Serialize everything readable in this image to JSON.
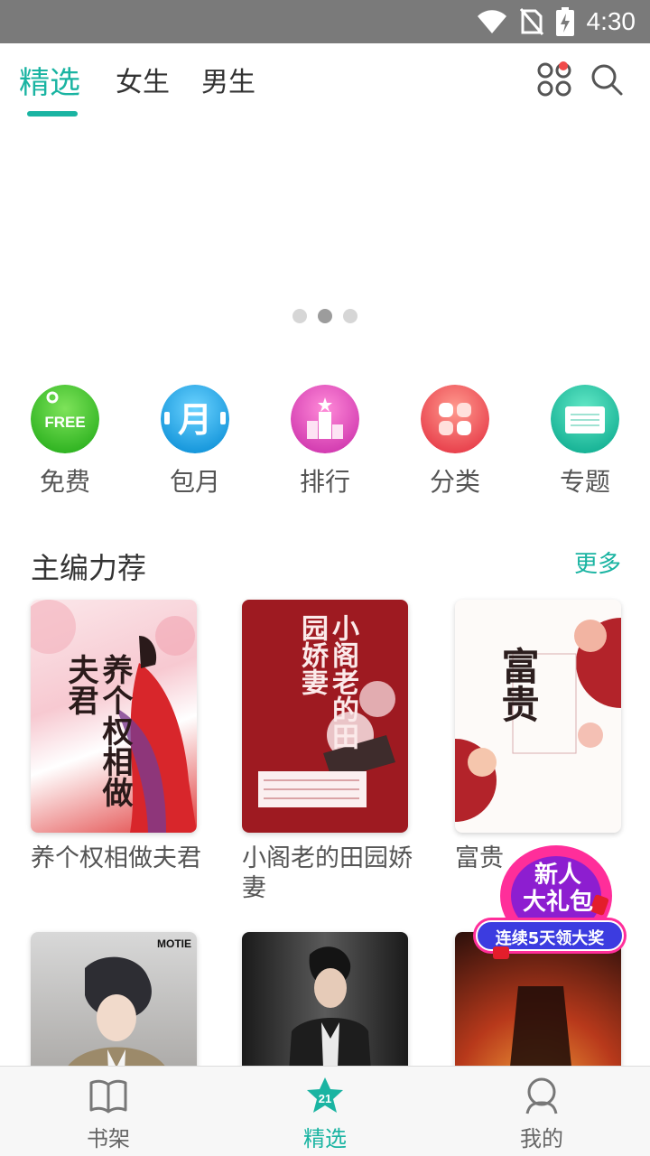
{
  "status_bar": {
    "time": "4:30",
    "icons": [
      "wifi-icon",
      "no-sim-icon",
      "battery-charging-icon"
    ]
  },
  "top_tabs": {
    "items": [
      {
        "label": "精选",
        "active": true
      },
      {
        "label": "女生",
        "active": false
      },
      {
        "label": "男生",
        "active": false
      }
    ],
    "actions": [
      "apps-grid-icon",
      "search-icon"
    ],
    "accent_color": "#1ab4a2"
  },
  "banner": {
    "page_count": 3,
    "active_index": 1
  },
  "quick_nav": [
    {
      "label": "免费",
      "icon": "free-icon",
      "badge_text": "FREE",
      "color": "#3cc42a"
    },
    {
      "label": "包月",
      "icon": "monthly-icon",
      "badge_text": "月",
      "color": "#27a6e6"
    },
    {
      "label": "排行",
      "icon": "ranking-podium-icon",
      "color": "#e055c0"
    },
    {
      "label": "分类",
      "icon": "category-grid-icon",
      "color": "#f0545a"
    },
    {
      "label": "专题",
      "icon": "topic-card-icon",
      "color": "#1ec5a5"
    }
  ],
  "section": {
    "title": "主编力荐",
    "more_label": "更多"
  },
  "books": [
    {
      "title": "养个权相做夫君",
      "cover_text": "养个权相做夫君"
    },
    {
      "title": "小阁老的田园娇妻",
      "cover_text": "小阁老的田园娇妻"
    },
    {
      "title": "富贵",
      "cover_text": "富贵"
    }
  ],
  "books_row2": [
    {
      "cover_logo": "MOTIE"
    },
    {
      "cover_logo": ""
    },
    {
      "cover_logo": ""
    }
  ],
  "promo": {
    "title_line1": "新人",
    "title_line2": "大礼包",
    "subtitle": "连续5天领大奖"
  },
  "bottom_nav": [
    {
      "label": "书架",
      "icon": "open-book-icon",
      "active": false
    },
    {
      "label": "精选",
      "icon": "star-icon",
      "active": true
    },
    {
      "label": "我的",
      "icon": "user-profile-icon",
      "active": false
    }
  ]
}
